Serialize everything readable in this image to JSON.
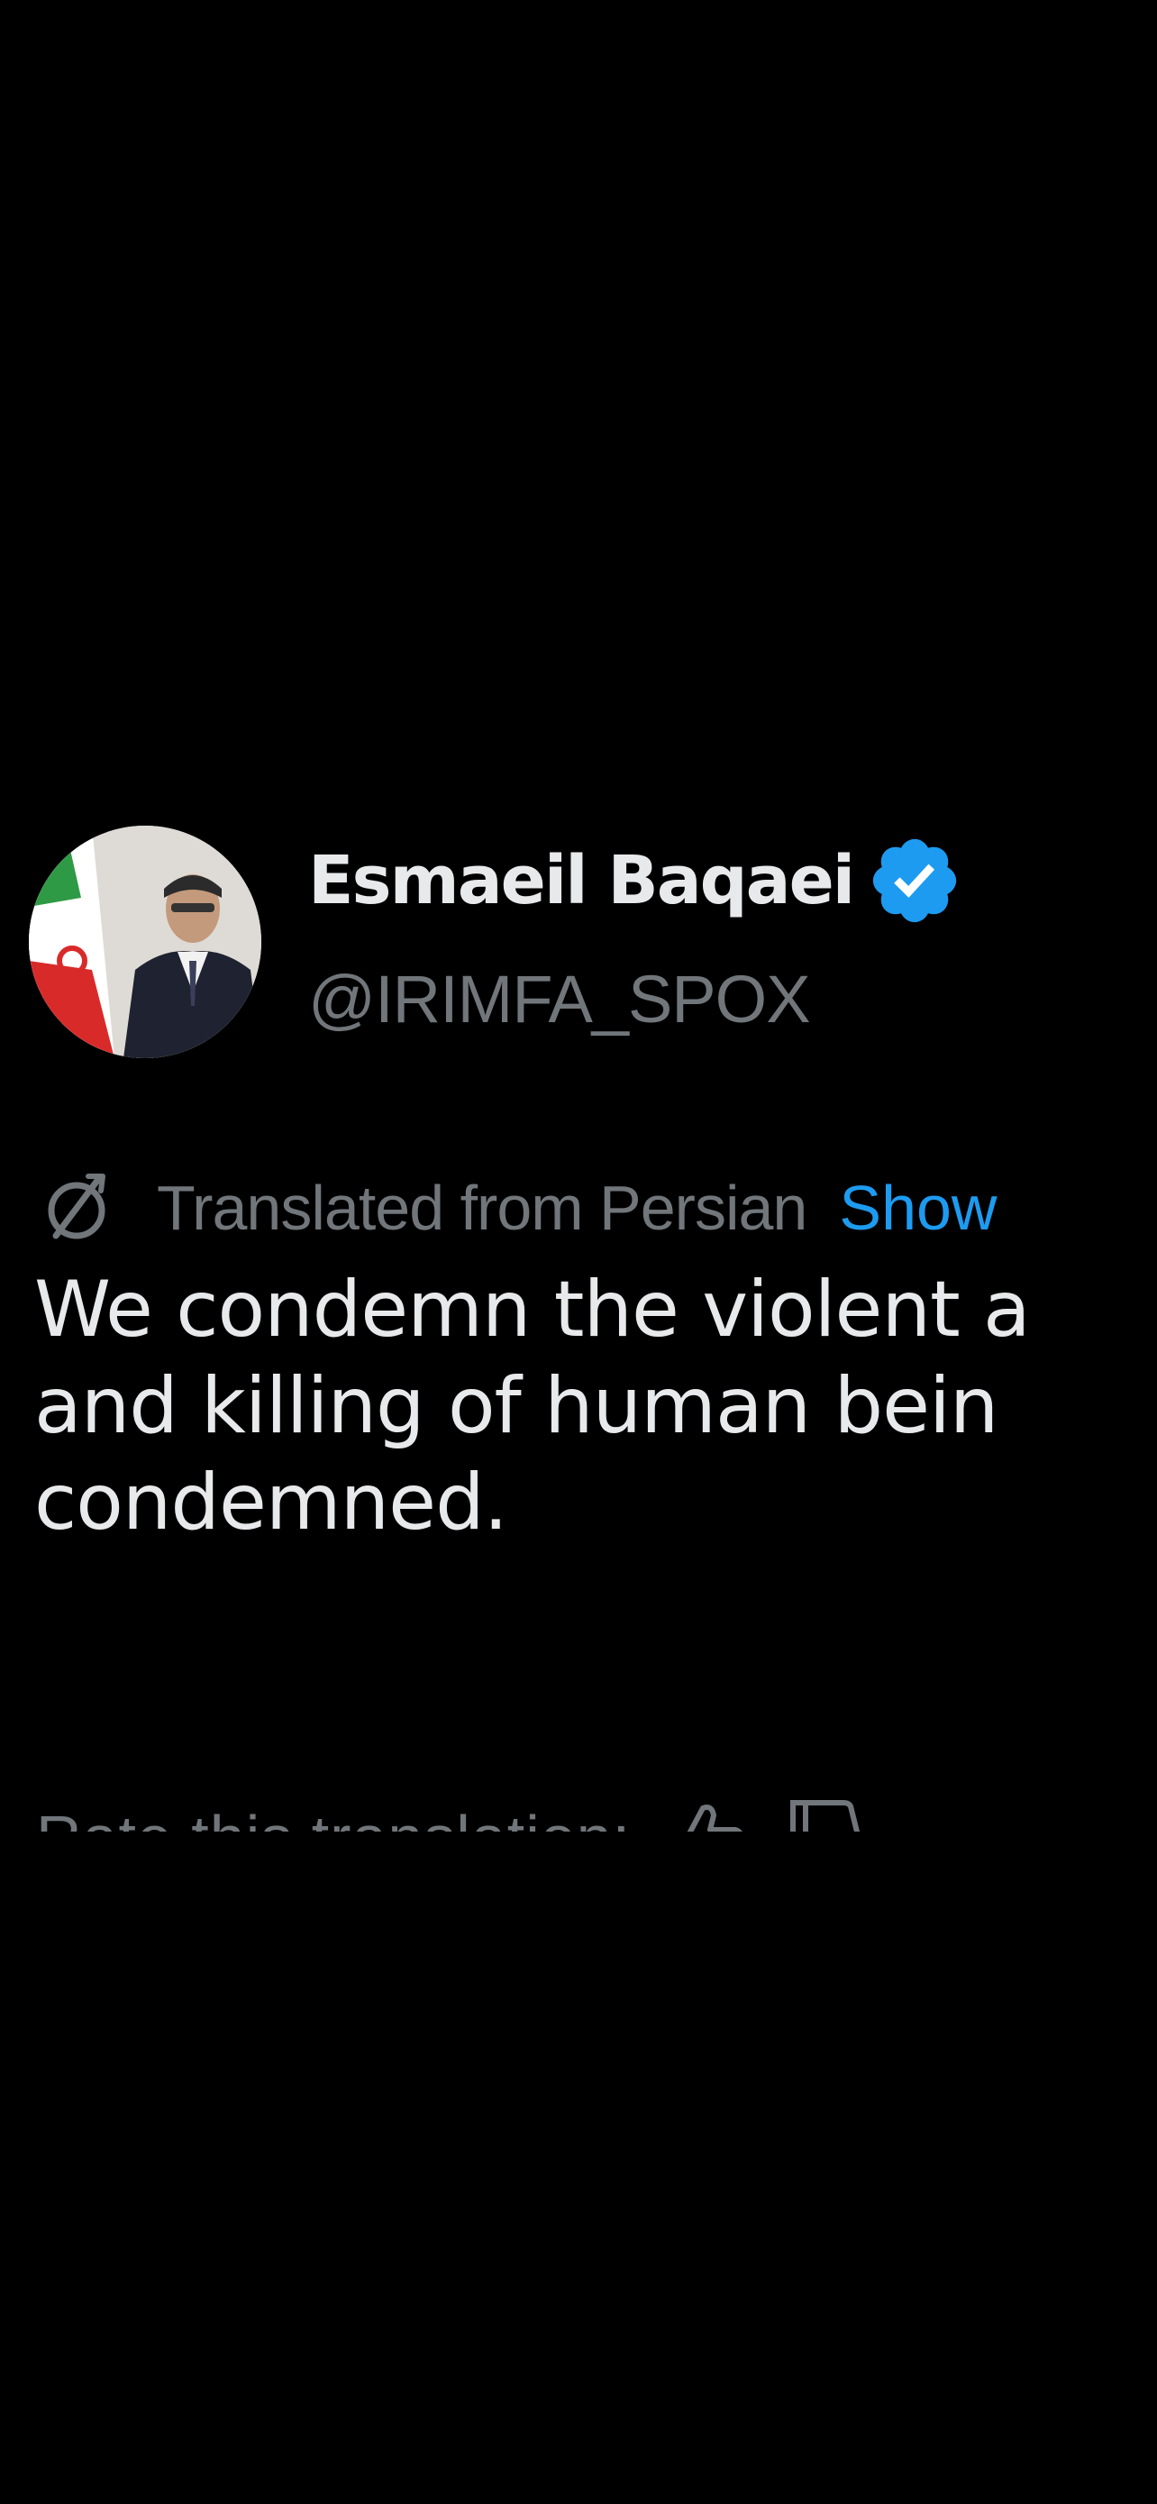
{
  "author": {
    "display_name": "Esmaeil Baqaei",
    "handle": "@IRIMFA_SPOX",
    "verified_icon": "verified-badge-icon",
    "verified_color": "#1d9bf0"
  },
  "translation": {
    "label": "Translated from Persian",
    "show_original": "Show",
    "icon": "translate-icon"
  },
  "tweet": {
    "lines": [
      "We condemn the violent a",
      "and killing of human bein",
      "condemned."
    ]
  },
  "rating": {
    "label": "Rate this translation:",
    "thumb_up_icon": "thumb-up-icon",
    "thumb_down_icon": "thumb-down-icon"
  },
  "colors": {
    "background": "#000000",
    "primary_text": "#e7e9ea",
    "secondary_text": "#71767b",
    "accent": "#1d9bf0"
  }
}
